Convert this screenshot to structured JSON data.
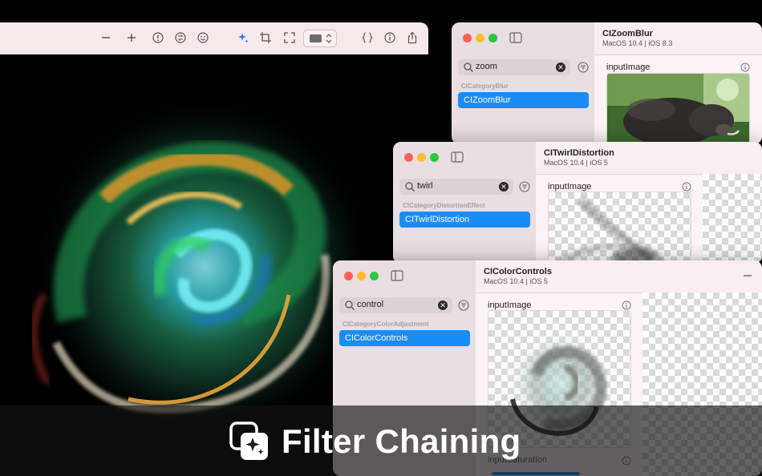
{
  "banner": {
    "title": "Filter Chaining",
    "icon": "sparkles-photo-stack-icon"
  },
  "main_window": {
    "toolbar": {
      "icons": [
        "minus-icon",
        "plus-icon",
        "alert-circle-icon",
        "flip-icon",
        "smiley-icon",
        "sparkles-icon",
        "crop-icon",
        "fullscreen-icon",
        "color-popup",
        "braces-icon",
        "info-icon",
        "share-icon"
      ],
      "background_color_swatch": "#6b6b6b"
    }
  },
  "windows": [
    {
      "id": "zoomblur",
      "search": {
        "value": "zoom"
      },
      "category": "CICategoryBlur",
      "selected_filter": "CIZoomBlur",
      "detail": {
        "title": "CIZoomBlur",
        "subtitle": "MacOS 10.4 | iOS 8.3",
        "param": "inputImage"
      }
    },
    {
      "id": "twirl",
      "search": {
        "value": "twirl"
      },
      "category": "CICategoryDistortionEffect",
      "selected_filter": "CITwirlDistortion",
      "detail": {
        "title": "CITwirlDistortion",
        "subtitle": "MacOS 10.4 | iOS 5",
        "param": "inputImage"
      }
    },
    {
      "id": "colorcontrols",
      "search": {
        "value": "control"
      },
      "category": "CICategoryColorAdjustment",
      "selected_filter": "CIColorControls",
      "detail": {
        "title": "CIColorControls",
        "subtitle": "MacOS 10.4 | iOS 5",
        "param": "inputImage",
        "param2": "inputSaturation"
      }
    }
  ],
  "colors": {
    "accent": "#1a8cf7",
    "toolbar_bg": "#f6e9ec"
  }
}
